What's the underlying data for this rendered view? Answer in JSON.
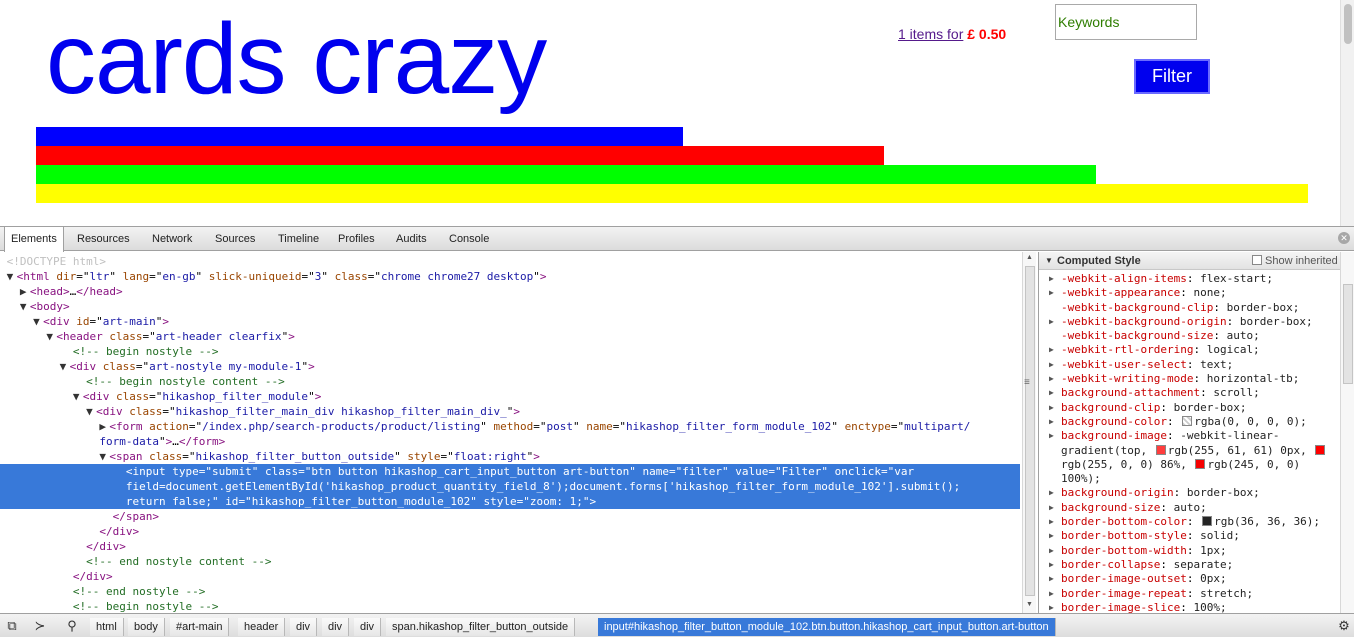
{
  "site": {
    "title": "cards crazy",
    "cart_link": "1 items for",
    "cart_price": "£ 0.50",
    "search_placeholder": "Keywords",
    "filter_button": "Filter",
    "bar_colors": [
      "#0000ff",
      "#ff0000",
      "#00ff00",
      "#ffff00"
    ]
  },
  "devtools": {
    "tabs": [
      "Elements",
      "Resources",
      "Network",
      "Sources",
      "Timeline",
      "Profiles",
      "Audits",
      "Console"
    ],
    "active_tab": "Elements",
    "dom_lines": [
      {
        "html": "<span class='doctype'>&lt;!DOCTYPE html&gt;</span>"
      },
      {
        "html": "<span class='tri'>▼</span><span class='tag'>&lt;html</span> <span class='attr'>dir</span>=\"<span class='val'>ltr</span>\" <span class='attr'>lang</span>=\"<span class='val'>en-gb</span>\" <span class='attr'>slick-uniqueid</span>=\"<span class='val'>3</span>\" <span class='attr'>class</span>=\"<span class='val'>chrome chrome27 desktop</span>\"<span class='tag'>&gt;</span>"
      },
      {
        "html": "  <span class='tri'>▶</span><span class='tag'>&lt;head&gt;</span>…<span class='tag'>&lt;/head&gt;</span>"
      },
      {
        "html": "  <span class='tri'>▼</span><span class='tag'>&lt;body&gt;</span>"
      },
      {
        "html": "    <span class='tri'>▼</span><span class='tag'>&lt;div</span> <span class='attr'>id</span>=\"<span class='val'>art-main</span>\"<span class='tag'>&gt;</span>"
      },
      {
        "html": "      <span class='tri'>▼</span><span class='tag'>&lt;header</span> <span class='attr'>class</span>=\"<span class='val'>art-header clearfix</span>\"<span class='tag'>&gt;</span>"
      },
      {
        "html": "          <span class='cmt'>&lt;!-- begin nostyle --&gt;</span>"
      },
      {
        "html": "        <span class='tri'>▼</span><span class='tag'>&lt;div</span> <span class='attr'>class</span>=\"<span class='val'>art-nostyle my-module-1</span>\"<span class='tag'>&gt;</span>"
      },
      {
        "html": "            <span class='cmt'>&lt;!-- begin nostyle content --&gt;</span>"
      },
      {
        "html": "          <span class='tri'>▼</span><span class='tag'>&lt;div</span> <span class='attr'>class</span>=\"<span class='val'>hikashop_filter_module</span>\"<span class='tag'>&gt;</span>"
      },
      {
        "html": "            <span class='tri'>▼</span><span class='tag'>&lt;div</span> <span class='attr'>class</span>=\"<span class='val'>hikashop_filter_main_div hikashop_filter_main_div_</span>\"<span class='tag'>&gt;</span>"
      },
      {
        "html": "              <span class='tri'>▶</span><span class='tag'>&lt;form</span> <span class='attr'>action</span>=\"<span class='val'>/index.php/search-products/product/listing</span>\" <span class='attr'>method</span>=\"<span class='val'>post</span>\" <span class='attr'>name</span>=\"<span class='val'>hikashop_filter_form_module_102</span>\" <span class='attr'>enctype</span>=\"<span class='val'>multipart/</span>"
      },
      {
        "html": "              <span class='val'>form-data</span>\"<span class='tag'>&gt;</span>…<span class='tag'>&lt;/form&gt;</span>"
      },
      {
        "html": "              <span class='tri'>▼</span><span class='tag'>&lt;span</span> <span class='attr'>class</span>=\"<span class='val'>hikashop_filter_button_outside</span>\" <span class='attr'>style</span>=\"<span class='val'>float:right</span>\"<span class='tag'>&gt;</span>"
      },
      {
        "html": "                  <span class='tag'>&lt;input</span> <span class='attr'>type</span>=\"<span class='val'>submit</span>\" <span class='attr'>class</span>=\"<span class='val'>btn button hikashop_cart_input_button art-button</span>\" <span class='attr'>name</span>=\"<span class='val'>filter</span>\" <span class='attr'>value</span>=\"<span class='val'>Filter</span>\" <span class='attr'>onclick</span>=\"<span class='val'>var</span>",
        "sel": true
      },
      {
        "html": "                  <span class='val'>field=document.getElementById('hikashop_product_quantity_field_8');document.forms['hikashop_filter_form_module_102'].submit();</span>",
        "sel": true
      },
      {
        "html": "                  <span class='val'>return false;</span>\" <span class='attr'>id</span>=\"<span class='val'>hikashop_filter_button_module_102</span>\" <span class='attr'>style</span>=\"<span class='val'>zoom: 1;</span>\"<span class='tag'>&gt;</span>",
        "sel": true
      },
      {
        "html": "                <span class='tag'>&lt;/span&gt;</span>"
      },
      {
        "html": "              <span class='tag'>&lt;/div&gt;</span>"
      },
      {
        "html": "            <span class='tag'>&lt;/div&gt;</span>"
      },
      {
        "html": "            <span class='cmt'>&lt;!-- end nostyle content --&gt;</span>"
      },
      {
        "html": "          <span class='tag'>&lt;/div&gt;</span>"
      },
      {
        "html": "          <span class='cmt'>&lt;!-- end nostyle --&gt;</span>"
      },
      {
        "html": "          <span class='cmt'>&lt;!-- begin nostyle --&gt;</span>"
      }
    ],
    "computed": {
      "title": "Computed Style",
      "show_inherited": "Show inherited",
      "props": [
        {
          "name": "-webkit-align-items",
          "value": "flex-start;",
          "exp": true
        },
        {
          "name": "-webkit-appearance",
          "value": "none;",
          "exp": true
        },
        {
          "name": "-webkit-background-clip",
          "value": "border-box;",
          "exp": false
        },
        {
          "name": "-webkit-background-origin",
          "value": "border-box;",
          "exp": true
        },
        {
          "name": "-webkit-background-size",
          "value": "auto;",
          "exp": false
        },
        {
          "name": "-webkit-rtl-ordering",
          "value": "logical;",
          "exp": true
        },
        {
          "name": "-webkit-user-select",
          "value": "text;",
          "exp": true
        },
        {
          "name": "-webkit-writing-mode",
          "value": "horizontal-tb;",
          "exp": true
        },
        {
          "name": "background-attachment",
          "value": "scroll;",
          "exp": true
        },
        {
          "name": "background-clip",
          "value": "border-box;",
          "exp": true
        },
        {
          "name": "background-color",
          "value": "rgba(0, 0, 0, 0);",
          "exp": true,
          "swatch": "transparent"
        },
        {
          "name": "background-image",
          "value": "-webkit-linear-gradient(top, ",
          "exp": true,
          "gradient": true
        },
        {
          "name": "background-origin",
          "value": "border-box;",
          "exp": true
        },
        {
          "name": "background-size",
          "value": "auto;",
          "exp": true
        },
        {
          "name": "border-bottom-color",
          "value": "rgb(36, 36, 36);",
          "exp": true,
          "swatch": "#242424"
        },
        {
          "name": "border-bottom-style",
          "value": "solid;",
          "exp": true
        },
        {
          "name": "border-bottom-width",
          "value": "1px;",
          "exp": true
        },
        {
          "name": "border-collapse",
          "value": "separate;",
          "exp": true
        },
        {
          "name": "border-image-outset",
          "value": "0px;",
          "exp": true
        },
        {
          "name": "border-image-repeat",
          "value": "stretch;",
          "exp": true
        },
        {
          "name": "border-image-slice",
          "value": "100%;",
          "exp": true
        }
      ],
      "gradient_parts": [
        "rgb(255, 61, 61) 0px,",
        "rgb(255, 0, 0) 86%,",
        "rgb(245, 0, 0)",
        "100%);"
      ],
      "gradient_colors": [
        "#ff3d3d",
        "#ff0000",
        "#f50000"
      ]
    },
    "breadcrumbs": [
      "html",
      "body",
      "#art-main",
      "header",
      "div",
      "div",
      "div",
      "span.hikashop_filter_button_outside",
      "input#hikashop_filter_button_module_102.btn.button.hikashop_cart_input_button.art-button"
    ],
    "status_icons": [
      "dock-icon",
      "console-drawer-icon",
      "search-icon"
    ],
    "settings_icon": "gear-icon"
  }
}
